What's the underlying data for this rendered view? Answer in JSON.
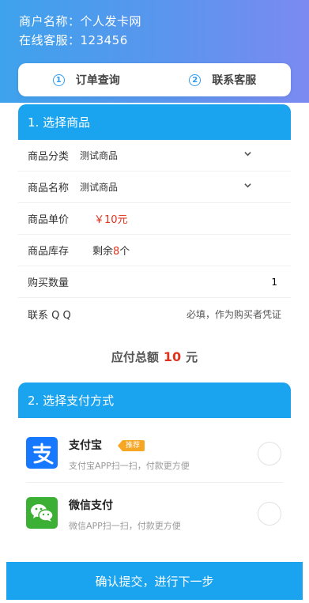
{
  "header": {
    "merchant_line": "商户名称：个人发卡网",
    "service_line": "在线客服：123456"
  },
  "tabs": [
    {
      "num": "①",
      "label": "订单查询"
    },
    {
      "num": "②",
      "label": "联系客服"
    }
  ],
  "section1": {
    "title": "1. 选择商品",
    "category_label": "商品分类",
    "category_value": "测试商品",
    "product_label": "商品名称",
    "product_value": "测试商品",
    "price_label": "商品单价",
    "price_value": "￥10元",
    "stock_label": "商品库存",
    "stock_prefix": "剩余",
    "stock_count": "8",
    "stock_suffix": "个",
    "qty_label": "购买数量",
    "qty_value": "1",
    "qq_label": "联系 Q Q",
    "qq_placeholder": "必填，作为购买者凭证"
  },
  "total": {
    "label": "应付总额",
    "amount": "10",
    "unit": "元"
  },
  "section2": {
    "title": "2. 选择支付方式",
    "methods": [
      {
        "name": "支付宝",
        "badge": "推荐",
        "desc": "支付宝APP扫一扫，付款更方便",
        "icon": "alipay-icon",
        "color": "#1677ff"
      },
      {
        "name": "微信支付",
        "desc": "微信APP扫一扫，付款更方便",
        "icon": "wechat-icon",
        "color": "#3cb035"
      }
    ]
  },
  "submit_label": "确认提交，进行下一步",
  "colors": {
    "accent": "#1aa3ee",
    "price": "#e0321c",
    "badge": "#f5a623"
  }
}
